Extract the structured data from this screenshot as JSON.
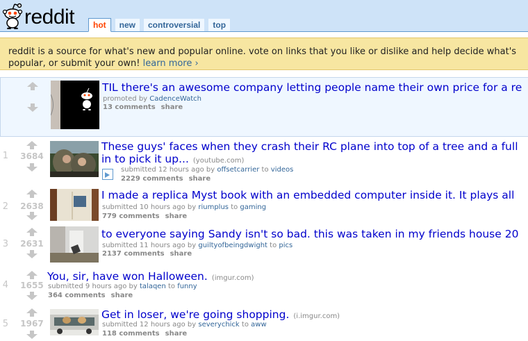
{
  "header": {
    "logo_text": "reddit",
    "tabs": [
      {
        "label": "hot",
        "selected": true
      },
      {
        "label": "new",
        "selected": false
      },
      {
        "label": "controversial",
        "selected": false
      },
      {
        "label": "top",
        "selected": false
      }
    ]
  },
  "infobar": {
    "line1": "reddit is a source for what's new and popular online. vote on links that you like or dislike and help decide what's",
    "line2": "popular, or submit your own! ",
    "learn_more": "learn more ›"
  },
  "promoted": {
    "title": "TIL there's an awesome company letting people name their own price for a re",
    "tagline_prefix": "promoted by ",
    "author": "CadenceWatch",
    "comments": "13 comments",
    "share": "share"
  },
  "posts": [
    {
      "rank": "1",
      "score": "3684",
      "title_line1": "These guys' faces when they crash their RC plane into top of a tree and a full",
      "title_line2": "in to pick it up...",
      "domain": "(youtube.com)",
      "age": "submitted 12 hours ago by ",
      "author": "offsetcarrier",
      "to": " to ",
      "subreddit": "videos",
      "comments": "2229 comments",
      "share": "share"
    },
    {
      "rank": "2",
      "score": "2638",
      "title_line1": "I made a replica Myst book with an embedded computer inside it. It plays all",
      "age": "submitted 10 hours ago by ",
      "author": "riumplus",
      "to": " to ",
      "subreddit": "gaming",
      "comments": "779 comments",
      "share": "share"
    },
    {
      "rank": "3",
      "score": "2631",
      "title_line1": "to everyone saying Sandy isn't so bad. this was taken in my friends house 20",
      "age": "submitted 11 hours ago by ",
      "author": "guiltyofbeingdwight",
      "to": " to ",
      "subreddit": "pics",
      "comments": "2137 comments",
      "share": "share"
    },
    {
      "rank": "4",
      "score": "1655",
      "title_line1": "You, sir, have won Halloween.",
      "domain": "(imgur.com)",
      "age": "submitted 9 hours ago by ",
      "author": "talaqen",
      "to": " to ",
      "subreddit": "funny",
      "comments": "364 comments",
      "share": "share"
    },
    {
      "rank": "5",
      "score": "1967",
      "title_line1": "Get in loser, we're going shopping.",
      "domain": "(i.imgur.com)",
      "age": "submitted 12 hours ago by ",
      "author": "severychick",
      "to": " to ",
      "subreddit": "aww",
      "comments": "118 comments",
      "share": "share"
    }
  ],
  "colors": {
    "header_bg": "#cee3f8",
    "link": "#0000cc",
    "accent": "#ff4500",
    "infobar_bg": "#f7e6a1"
  }
}
